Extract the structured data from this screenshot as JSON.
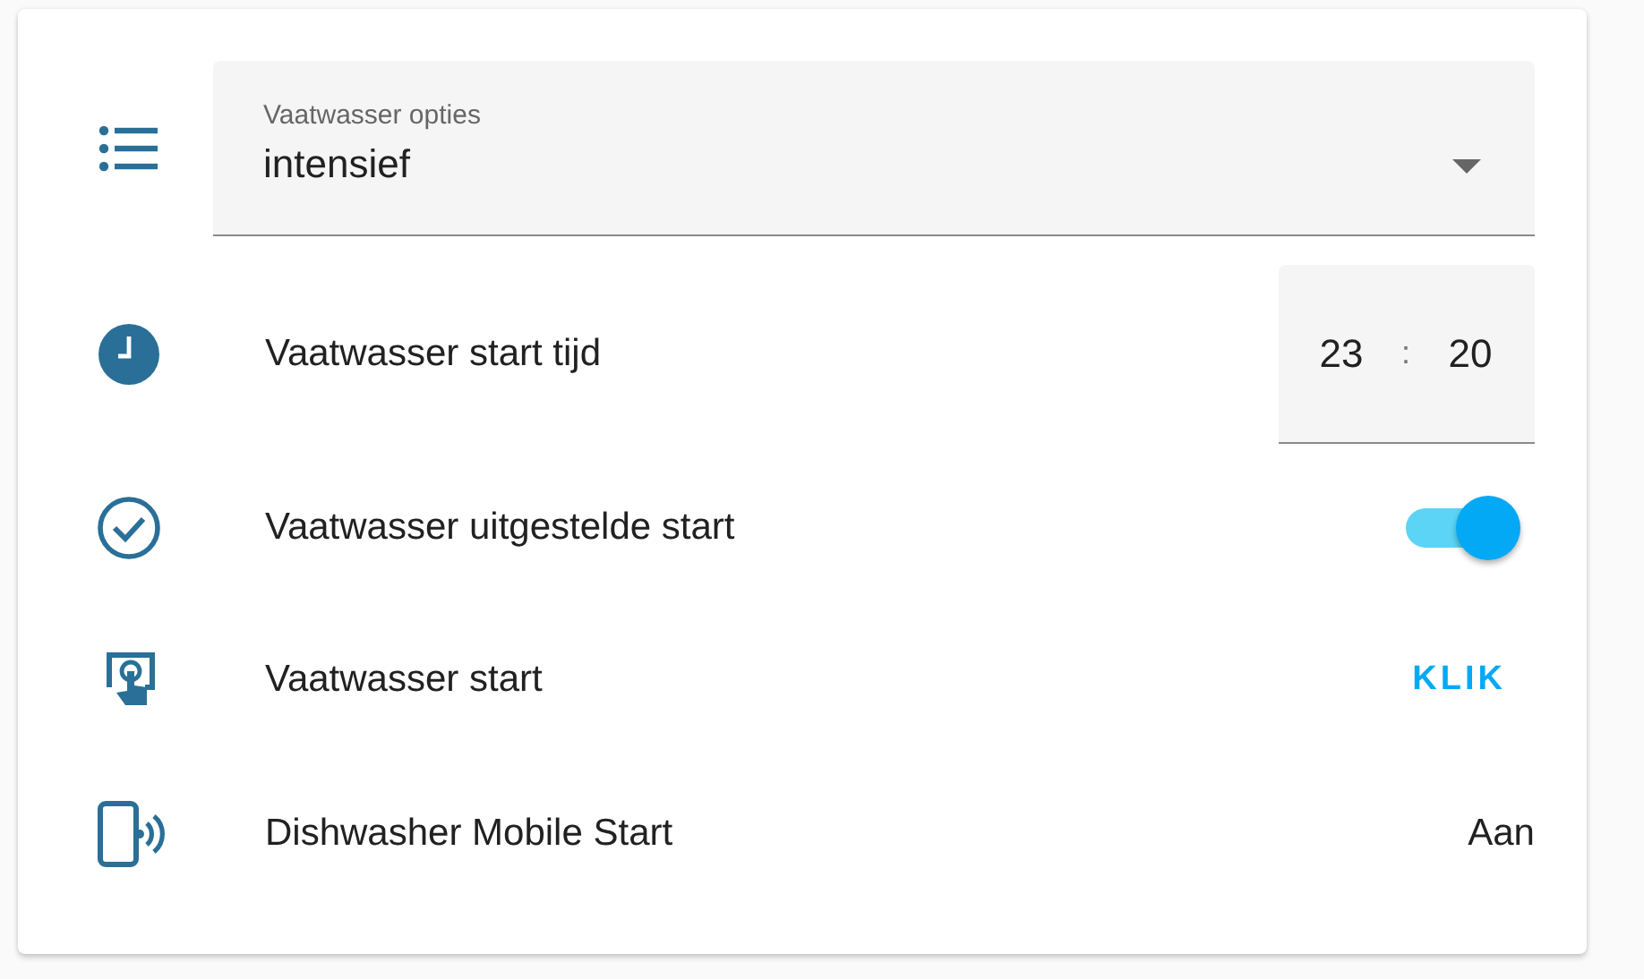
{
  "rows": [
    {
      "kind": "select",
      "label": "Vaatwasser opties",
      "value": "intensief"
    },
    {
      "kind": "time",
      "label": "Vaatwasser start tijd",
      "hours": "23",
      "separator": ":",
      "minutes": "20"
    },
    {
      "kind": "toggle",
      "label": "Vaatwasser uitgestelde start",
      "on": true
    },
    {
      "kind": "button",
      "label": "Vaatwasser start",
      "action": "KLIK"
    },
    {
      "kind": "state",
      "label": "Dishwasher Mobile Start",
      "state": "Aan"
    }
  ]
}
